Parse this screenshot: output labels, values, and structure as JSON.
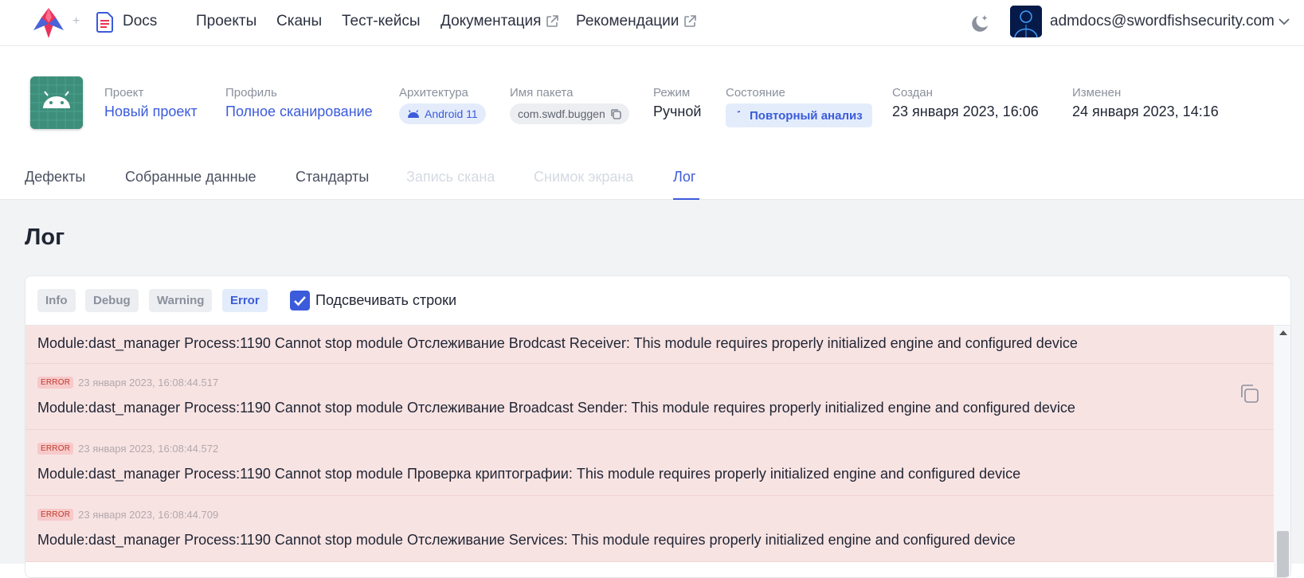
{
  "nav": {
    "plus": "+",
    "docs_label": "Docs",
    "items": [
      {
        "label": "Проекты",
        "external": false
      },
      {
        "label": "Сканы",
        "external": false
      },
      {
        "label": "Тест-кейсы",
        "external": false
      },
      {
        "label": "Документация",
        "external": true
      },
      {
        "label": "Рекомендации",
        "external": true
      }
    ],
    "user_email": "admdocs@swordfishsecurity.com"
  },
  "scan": {
    "project": {
      "label": "Проект",
      "value": "Новый проект"
    },
    "profile": {
      "label": "Профиль",
      "value": "Полное сканирование"
    },
    "architecture": {
      "label": "Архитектура",
      "value": "Android 11"
    },
    "package": {
      "label": "Имя пакета",
      "value": "com.swdf.buggen"
    },
    "mode": {
      "label": "Режим",
      "value": "Ручной"
    },
    "state": {
      "label": "Состояние",
      "value": "Повторный анализ"
    },
    "created": {
      "label": "Создан",
      "value": "23 января 2023, 16:06"
    },
    "modified": {
      "label": "Изменен",
      "value": "24 января 2023, 14:16"
    }
  },
  "tabs": [
    {
      "label": "Дефекты",
      "state": "normal"
    },
    {
      "label": "Собранные данные",
      "state": "normal"
    },
    {
      "label": "Стандарты",
      "state": "normal"
    },
    {
      "label": "Запись скана",
      "state": "disabled"
    },
    {
      "label": "Снимок экрана",
      "state": "disabled"
    },
    {
      "label": "Лог",
      "state": "active"
    }
  ],
  "page_title": "Лог",
  "log": {
    "levels": [
      {
        "label": "Info",
        "active": false
      },
      {
        "label": "Debug",
        "active": false
      },
      {
        "label": "Warning",
        "active": false
      },
      {
        "label": "Error",
        "active": true
      }
    ],
    "highlight_label": "Подсвечивать строки",
    "highlight_checked": true,
    "entries": [
      {
        "level": "",
        "timestamp": "",
        "message": "Module:dast_manager Process:1190 Cannot stop module Отслеживание Brodcast Receiver: This module requires properly initialized engine and configured device"
      },
      {
        "level": "ERROR",
        "timestamp": "23 января 2023, 16:08:44.517",
        "message": "Module:dast_manager Process:1190 Cannot stop module Отслеживание Broadcast Sender: This module requires properly initialized engine and configured device"
      },
      {
        "level": "ERROR",
        "timestamp": "23 января 2023, 16:08:44.572",
        "message": "Module:dast_manager Process:1190 Cannot stop module Проверка криптографии: This module requires properly initialized engine and configured device"
      },
      {
        "level": "ERROR",
        "timestamp": "23 января 2023, 16:08:44.709",
        "message": "Module:dast_manager Process:1190 Cannot stop module Отслеживание Services: This module requires properly initialized engine and configured device"
      }
    ]
  },
  "colors": {
    "accent": "#3b5bdb",
    "error_row_bg": "#f8e3e3",
    "error_badge": "#c0392b"
  }
}
